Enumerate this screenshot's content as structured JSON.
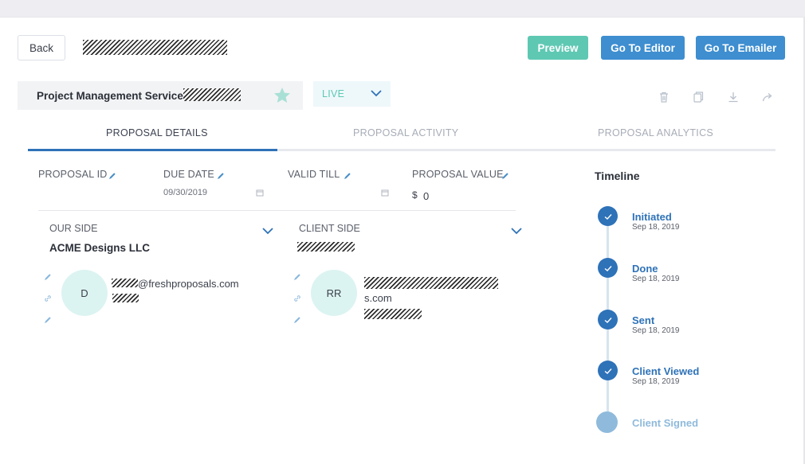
{
  "header": {
    "back_label": "Back",
    "preview_label": "Preview",
    "editor_label": "Go To Editor",
    "emailer_label": "Go To Emailer"
  },
  "project": {
    "name": "Project Management Services",
    "status": "LIVE"
  },
  "tabs": [
    {
      "label": "PROPOSAL DETAILS",
      "active": true
    },
    {
      "label": "PROPOSAL ACTIVITY",
      "active": false
    },
    {
      "label": "PROPOSAL ANALYTICS",
      "active": false
    }
  ],
  "details": {
    "proposal_id_label": "PROPOSAL ID",
    "due_date_label": "DUE DATE",
    "due_date_value": "09/30/2019",
    "valid_till_label": "VALID TILL",
    "proposal_value_label": "PROPOSAL VALUE",
    "currency": "$",
    "proposal_value": "0"
  },
  "our_side": {
    "label": "OUR SIDE",
    "company": "ACME Designs LLC",
    "avatar_initials": "D",
    "email_suffix": "@freshproposals.com"
  },
  "client_side": {
    "label": "CLIENT SIDE",
    "avatar_initials": "RR",
    "email_suffix": "s.com"
  },
  "timeline": {
    "title": "Timeline",
    "events": [
      {
        "label": "Initiated",
        "date": "Sep 18, 2019",
        "done": true
      },
      {
        "label": "Done",
        "date": "Sep 18, 2019",
        "done": true
      },
      {
        "label": "Sent",
        "date": "Sep 18, 2019",
        "done": true
      },
      {
        "label": "Client Viewed",
        "date": "Sep 18, 2019",
        "done": true
      },
      {
        "label": "Client Signed",
        "date": "",
        "done": false
      }
    ]
  },
  "icons": {
    "star": "star-icon",
    "status_dropdown": "chevron-down-icon",
    "delete": "trash-icon",
    "duplicate": "copy-icon",
    "download": "download-icon",
    "share": "share-icon",
    "edit": "pencil-icon",
    "calendar": "calendar-icon",
    "link": "link-icon",
    "check": "check-icon"
  },
  "colors": {
    "primary": "#3e8ed0",
    "accent": "#5ec8b3",
    "timeline_done": "#2e72b8",
    "timeline_pending": "#8fbadb"
  }
}
